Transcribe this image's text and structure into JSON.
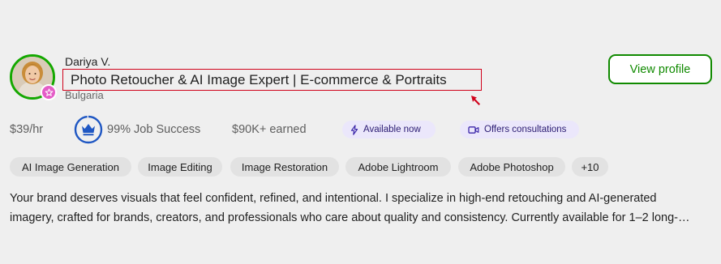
{
  "freelancer": {
    "name": "Dariya V.",
    "title": "Photo Retoucher & AI Image Expert | E-commerce & Portraits",
    "location": "Bulgaria"
  },
  "actions": {
    "view_profile": "View profile"
  },
  "stats": {
    "rate": "$39/hr",
    "job_success": "99% Job Success",
    "earned": "$90K+ earned"
  },
  "badges": {
    "available": "Available now",
    "consultations": "Offers consultations"
  },
  "skills": [
    "AI Image Generation",
    "Image Editing",
    "Image Restoration",
    "Adobe Lightroom",
    "Adobe Photoshop",
    "+10"
  ],
  "description": {
    "line1": "Your brand deserves visuals that feel confident, refined, and intentional. I specialize in high-end retouching and AI-generated",
    "line2": "imagery, crafted for brands, creators, and professionals who care about quality and consistency. Currently available for 1–2 long-…"
  },
  "colors": {
    "accent_green": "#108a00",
    "highlight_red": "#d0021b",
    "badge_purple_bg": "#ebe7fb",
    "badge_purple_text": "#2a1b72",
    "job_success_blue": "#1f57c3"
  },
  "icons": {
    "avatar_badge": "top-rated-badge-icon",
    "job_success": "crown-icon",
    "available": "lightning-icon",
    "consultations": "video-icon",
    "cursor": "cursor-arrow-icon"
  }
}
